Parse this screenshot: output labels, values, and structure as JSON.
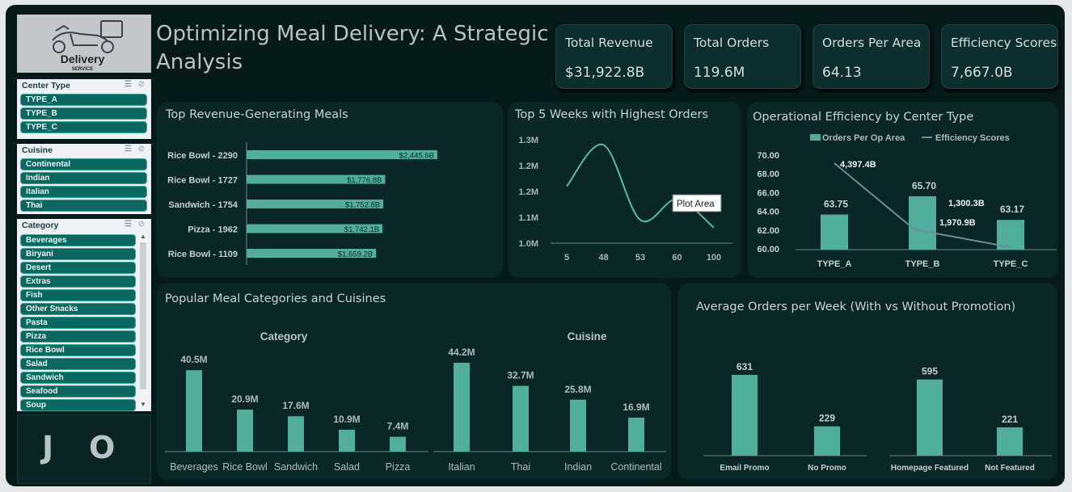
{
  "logo": {
    "line1": "Delivery",
    "line2": "SERVICE"
  },
  "title": "Optimizing Meal Delivery: A Strategic Analysis",
  "kpis": [
    {
      "label": "Total Revenue",
      "value": "$31,922.8B"
    },
    {
      "label": "Total Orders",
      "value": "119.6M"
    },
    {
      "label": "Orders Per Area",
      "value": "64.13"
    },
    {
      "label": "Efficiency Scores",
      "value": "7,667.0B"
    }
  ],
  "slicers": {
    "center_type": {
      "title": "Center Type",
      "items": [
        "TYPE_A",
        "TYPE_B",
        "TYPE_C"
      ]
    },
    "cuisine": {
      "title": "Cuisine",
      "items": [
        "Continental",
        "Indian",
        "Italian",
        "Thai"
      ]
    },
    "category": {
      "title": "Category",
      "items": [
        "Beverages",
        "Biryani",
        "Desert",
        "Extras",
        "Fish",
        "Other Snacks",
        "Pasta",
        "Pizza",
        "Rice Bowl",
        "Salad",
        "Sandwich",
        "Seafood",
        "Soup"
      ]
    }
  },
  "monogram": {
    "left": "J",
    "right": "O"
  },
  "colors": {
    "bar": "#4fae9c",
    "line": "#6f8c99",
    "bg": "#061a1a",
    "card": "#0a2727"
  },
  "chart_data": [
    {
      "id": "revenue",
      "type": "bar",
      "orientation": "horizontal",
      "title": "Top Revenue-Generating Meals",
      "categories": [
        "Rice Bowl - 2290",
        "Rice Bowl - 1727",
        "Sandwich - 1754",
        "Pizza - 1962",
        "Rice Bowl - 1109"
      ],
      "values": [
        2445.6,
        1776.8,
        1752.8,
        1742.1,
        1659.2
      ],
      "labels": [
        "$2,445.6B",
        "$1,776.8B",
        "$1,752.8B",
        "$1,742.1B",
        "$1,659.2B"
      ]
    },
    {
      "id": "weeks",
      "type": "line",
      "title": "Top 5 Weeks with Highest Orders",
      "x": [
        "5",
        "48",
        "53",
        "60",
        "100"
      ],
      "values": [
        1.22,
        1.38,
        1.09,
        1.17,
        1.06
      ],
      "yticks": [
        "1.3M",
        "1.2M",
        "1.2M",
        "1.1M",
        "1.0M"
      ],
      "ylim": [
        1.0,
        1.4
      ],
      "tooltip": "Plot Area"
    },
    {
      "id": "efficiency",
      "type": "bar",
      "title": "Operational Efficiency by Center Type",
      "legend": [
        "Orders Per Op Area",
        "Efficiency Scores"
      ],
      "categories": [
        "TYPE_A",
        "TYPE_B",
        "TYPE_C"
      ],
      "values": [
        63.75,
        65.7,
        63.17
      ],
      "labels": [
        "63.75",
        "65.70",
        "63.17"
      ],
      "line_values": [
        4397.4,
        1970.9,
        1300.3
      ],
      "line_labels": [
        "4,397.4B",
        "1,970.9B",
        "1,300.3B"
      ],
      "yticks": [
        "70.00",
        "68.00",
        "66.00",
        "64.00",
        "62.00",
        "60.00"
      ],
      "ylim": [
        60,
        70
      ]
    },
    {
      "id": "popular",
      "type": "bar",
      "title": "Popular Meal Categories and Cuisines",
      "groups": [
        {
          "name": "Category",
          "categories": [
            "Beverages",
            "Rice Bowl",
            "Sandwich",
            "Salad",
            "Pizza"
          ],
          "values": [
            40.5,
            20.9,
            17.6,
            10.9,
            7.4
          ],
          "labels": [
            "40.5M",
            "20.9M",
            "17.6M",
            "10.9M",
            "7.4M"
          ]
        },
        {
          "name": "Cuisine",
          "categories": [
            "Italian",
            "Thai",
            "Indian",
            "Continental"
          ],
          "values": [
            44.2,
            32.7,
            25.8,
            16.9
          ],
          "labels": [
            "44.2M",
            "32.7M",
            "25.8M",
            "16.9M"
          ]
        }
      ]
    },
    {
      "id": "promo",
      "type": "bar",
      "title": "Average Orders per Week (With vs Without Promotion)",
      "groups": [
        {
          "categories": [
            "Email Promo",
            "No Promo"
          ],
          "values": [
            631,
            229
          ],
          "labels": [
            "631",
            "229"
          ]
        },
        {
          "categories": [
            "Homepage Featured",
            "Not Featured"
          ],
          "values": [
            595,
            221
          ],
          "labels": [
            "595",
            "221"
          ]
        }
      ]
    }
  ]
}
